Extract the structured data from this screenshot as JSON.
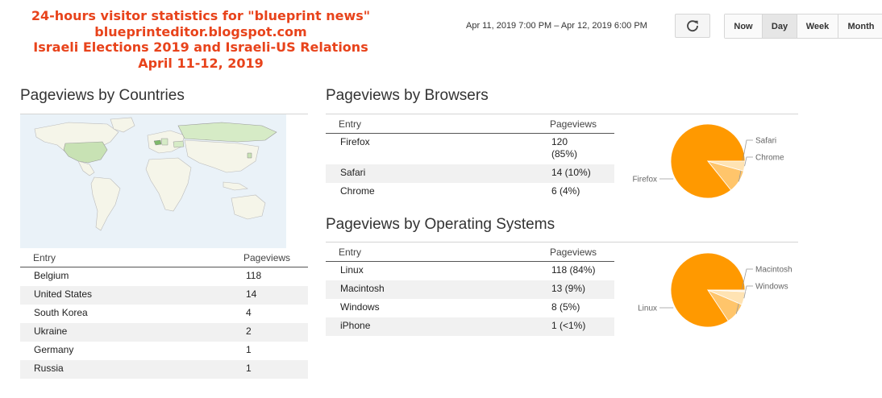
{
  "banner": {
    "line1": "24-hours visitor statistics for \"blueprint news\"",
    "line2": "blueprinteditor.blogspot.com",
    "line3": "Israeli Elections 2019 and Israeli-US Relations",
    "line4": "April 11-12, 2019"
  },
  "toolbar": {
    "date_range": "Apr 11, 2019 7:00 PM – Apr 12, 2019 6:00 PM",
    "refresh_icon": "refresh-icon",
    "ranges": [
      {
        "label": "Now",
        "active": false
      },
      {
        "label": "Day",
        "active": true
      },
      {
        "label": "Week",
        "active": false
      },
      {
        "label": "Month",
        "active": false
      }
    ]
  },
  "countries": {
    "title": "Pageviews by Countries",
    "header": {
      "entry": "Entry",
      "pageviews": "Pageviews"
    },
    "rows": [
      {
        "entry": "Belgium",
        "pageviews": "118"
      },
      {
        "entry": "United States",
        "pageviews": "14"
      },
      {
        "entry": "South Korea",
        "pageviews": "4"
      },
      {
        "entry": "Ukraine",
        "pageviews": "2"
      },
      {
        "entry": "Germany",
        "pageviews": "1"
      },
      {
        "entry": "Russia",
        "pageviews": "1"
      }
    ]
  },
  "browsers": {
    "title": "Pageviews by Browsers",
    "header": {
      "entry": "Entry",
      "pageviews": "Pageviews"
    },
    "rows": [
      {
        "entry": "Firefox",
        "pageviews": "120\n(85%)"
      },
      {
        "entry": "Safari",
        "pageviews": "14 (10%)"
      },
      {
        "entry": "Chrome",
        "pageviews": "6 (4%)"
      }
    ]
  },
  "os": {
    "title": "Pageviews by Operating Systems",
    "header": {
      "entry": "Entry",
      "pageviews": "Pageviews"
    },
    "rows": [
      {
        "entry": "Linux",
        "pageviews": "118 (84%)"
      },
      {
        "entry": "Macintosh",
        "pageviews": "13 (9%)"
      },
      {
        "entry": "Windows",
        "pageviews": "8 (5%)"
      },
      {
        "entry": "iPhone",
        "pageviews": "1 (<1%)"
      }
    ]
  },
  "chart_data": [
    {
      "type": "pie",
      "slices": [
        {
          "label": "Firefox",
          "value": 120,
          "color": "#ff9900"
        },
        {
          "label": "Safari",
          "value": 14,
          "color": "#ffc56b"
        },
        {
          "label": "Chrome",
          "value": 6,
          "color": "#ffe3b3"
        }
      ]
    },
    {
      "type": "pie",
      "slices": [
        {
          "label": "Linux",
          "value": 118,
          "color": "#ff9900"
        },
        {
          "label": "Macintosh",
          "value": 13,
          "color": "#ffc56b"
        },
        {
          "label": "Windows",
          "value": 8,
          "color": "#ffe3b3"
        },
        {
          "label": "iPhone",
          "value": 1,
          "color": "#fff1d9",
          "label_visible": false
        }
      ]
    }
  ],
  "colors": {
    "banner": "#e8431b",
    "map_water": "#eaf2f8",
    "map_land": "#f5f5e9",
    "map_highlight": "#c8e2b4"
  }
}
